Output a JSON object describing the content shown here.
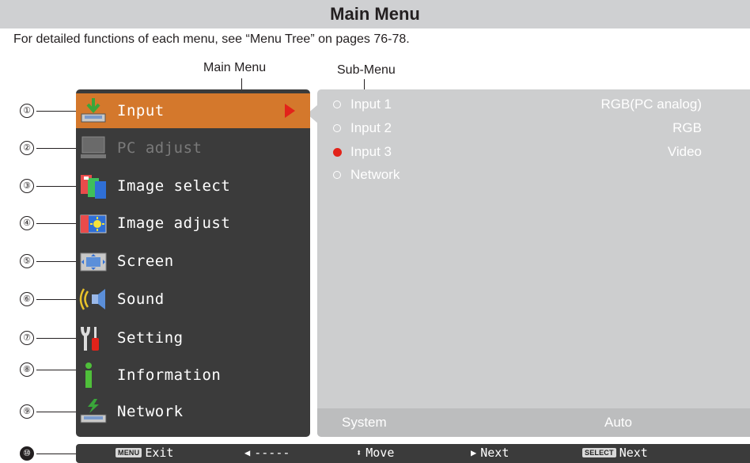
{
  "header": {
    "title": "Main Menu"
  },
  "intro": "For detailed functions of each menu, see “Menu Tree” on pages 76-78.",
  "callouts": {
    "main_menu": "Main Menu",
    "sub_menu": "Sub-Menu"
  },
  "menu": {
    "items": [
      {
        "num": "①",
        "label": "Input",
        "icon": "input-icon",
        "state": "active"
      },
      {
        "num": "②",
        "label": "PC adjust",
        "icon": "pc-adjust-icon",
        "state": "disabled"
      },
      {
        "num": "③",
        "label": "Image select",
        "icon": "image-select-icon",
        "state": "normal"
      },
      {
        "num": "④",
        "label": "Image adjust",
        "icon": "image-adjust-icon",
        "state": "normal"
      },
      {
        "num": "⑤",
        "label": "Screen",
        "icon": "screen-icon",
        "state": "normal"
      },
      {
        "num": "⑥",
        "label": "Sound",
        "icon": "sound-icon",
        "state": "normal"
      },
      {
        "num": "⑦",
        "label": "Setting",
        "icon": "setting-icon",
        "state": "normal"
      },
      {
        "num": "⑧",
        "label": "Information",
        "icon": "information-icon",
        "state": "normal"
      },
      {
        "num": "⑨",
        "label": "Network",
        "icon": "network-icon",
        "state": "normal"
      }
    ]
  },
  "submenu": {
    "rows": [
      {
        "name": "Input 1",
        "value": "RGB(PC analog)",
        "selected": false
      },
      {
        "name": "Input 2",
        "value": "RGB",
        "selected": false
      },
      {
        "name": "Input 3",
        "value": "Video",
        "selected": true
      },
      {
        "name": "Network",
        "value": "",
        "selected": false
      }
    ],
    "footer": {
      "label": "System",
      "value": "Auto"
    }
  },
  "bottom_bar": {
    "num": "⑩",
    "exit": {
      "key": "MENU",
      "label": "Exit"
    },
    "back": {
      "label": "-----"
    },
    "move": {
      "label": "Move"
    },
    "next": {
      "label": "Next"
    },
    "select": {
      "key": "SELECT",
      "label": "Next"
    }
  },
  "colors": {
    "active": "#d4782c",
    "panel": "#3b3b3b",
    "sub_panel": "#cdcecf",
    "selected_dot": "#e2231a"
  }
}
